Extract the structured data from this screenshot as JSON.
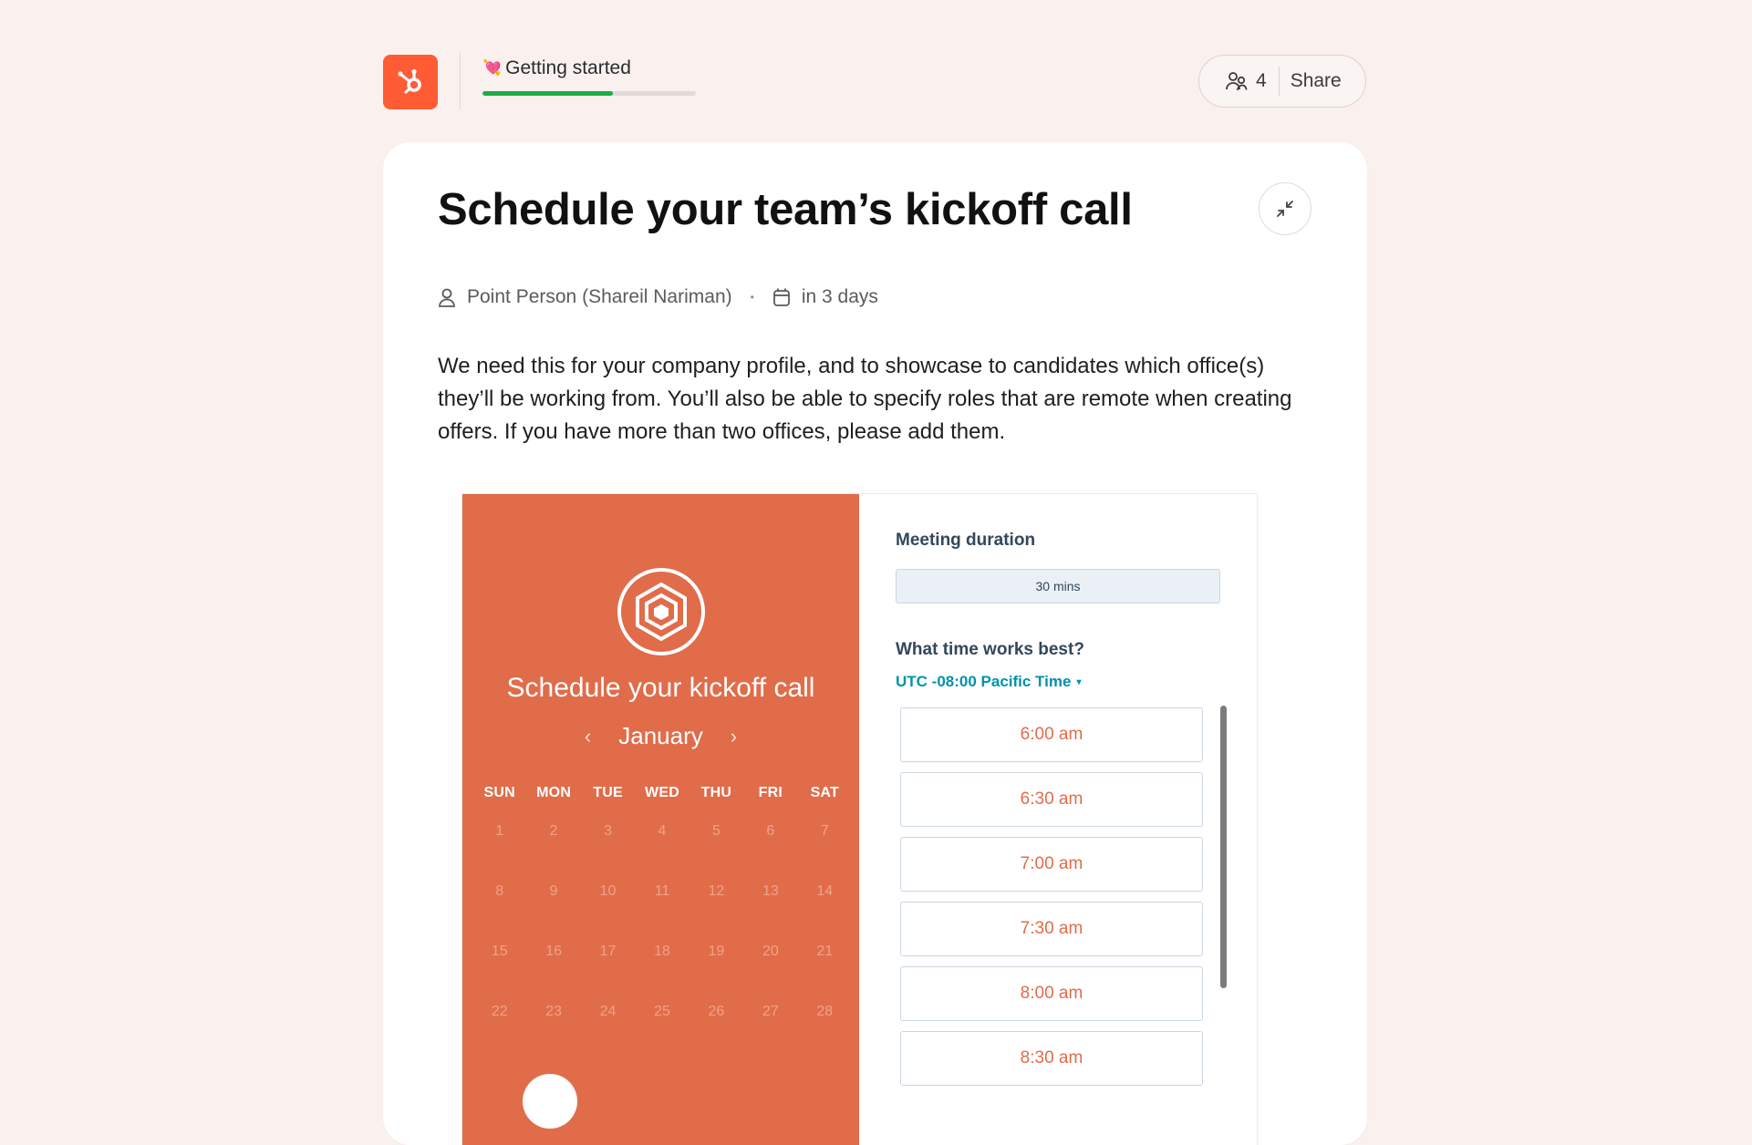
{
  "header": {
    "logo": "hubspot-logo",
    "getting_started": {
      "emoji": "💘",
      "label": "Getting started",
      "progress_percent": 61
    },
    "members_count": "4",
    "share_label": "Share"
  },
  "task": {
    "title": "Schedule your team’s kickoff call",
    "assignee": "Point Person (Shareil Nariman)",
    "meta_separator": "•",
    "due": "in 3 days",
    "description": "We need this for your company profile, and to showcase to candidates which office(s) they’ll be working from. You’ll also be able to specify roles that are remote when creating offers. If you have more than two offices, please add them."
  },
  "embed": {
    "title": "Schedule your kickoff call",
    "month": "January",
    "prev": "‹",
    "next": "›",
    "days_of_week": [
      "SUN",
      "MON",
      "TUE",
      "WED",
      "THU",
      "FRI",
      "SAT"
    ],
    "weeks": [
      [
        "1",
        "2",
        "3",
        "4",
        "5",
        "6",
        "7"
      ],
      [
        "8",
        "9",
        "10",
        "11",
        "12",
        "13",
        "14"
      ],
      [
        "15",
        "16",
        "17",
        "18",
        "19",
        "20",
        "21"
      ],
      [
        "22",
        "23",
        "24",
        "25",
        "26",
        "27",
        "28"
      ]
    ],
    "meeting_duration_label": "Meeting duration",
    "duration_value": "30 mins",
    "time_question": "What time works best?",
    "timezone": "UTC -08:00 Pacific Time",
    "timezone_caret": "▾",
    "slots": [
      "6:00 am",
      "6:30 am",
      "7:00 am",
      "7:30 am",
      "8:00 am",
      "8:30 am"
    ]
  },
  "colors": {
    "background": "#faf1ef",
    "brand_orange": "#ff5c35",
    "calendar_orange": "#e06c4a",
    "progress_green": "#1faa4a",
    "timezone_link": "#0091ae"
  }
}
